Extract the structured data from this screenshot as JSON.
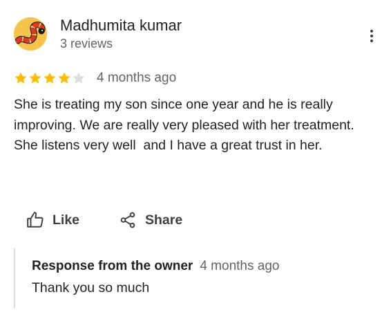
{
  "review": {
    "author": {
      "name": "Madhumita kumar",
      "meta": "3 reviews",
      "avatar_icon": "snake-avatar",
      "avatar_bg": "#f5c44a"
    },
    "more_icon": "more-vertical-icon",
    "rating": {
      "value": 4,
      "max": 5,
      "star_filled_color": "#fbbc04",
      "star_empty_color": "#dadce0"
    },
    "time": "4 months ago",
    "text": "She is treating my son since one year and he is really improving. We are really very pleased with her treatment. She listens very well  and I have a great trust in her.",
    "actions": {
      "like_label": "Like",
      "like_icon": "thumbs-up-icon",
      "share_label": "Share",
      "share_icon": "share-icon"
    },
    "owner_response": {
      "title": "Response from the owner",
      "time": "4 months ago",
      "text": "Thank you so much"
    }
  }
}
